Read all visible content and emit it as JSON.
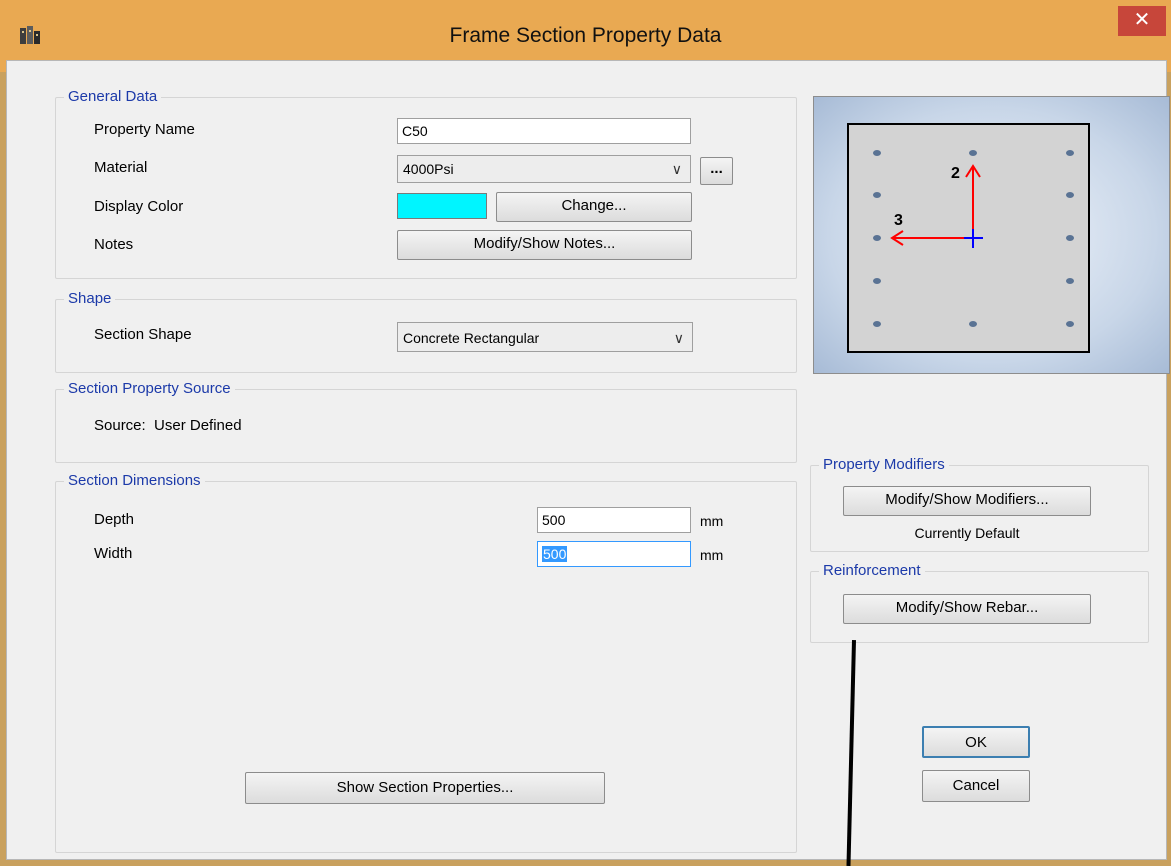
{
  "window": {
    "title": "Frame Section Property Data",
    "close_glyph": "✕"
  },
  "general_data": {
    "group_label": "General Data",
    "property_name_label": "Property Name",
    "property_name_value": "C50",
    "material_label": "Material",
    "material_value": "4000Psi",
    "material_more_label": "...",
    "display_color_label": "Display Color",
    "display_color_hex": "#00f5ff",
    "change_button_label": "Change...",
    "notes_label": "Notes",
    "notes_button_label": "Modify/Show Notes..."
  },
  "shape": {
    "group_label": "Shape",
    "section_shape_label": "Section Shape",
    "section_shape_value": "Concrete Rectangular"
  },
  "source": {
    "group_label": "Section Property Source",
    "source_text": "Source:  User Defined"
  },
  "dimensions": {
    "group_label": "Section Dimensions",
    "depth_label": "Depth",
    "depth_value": "500",
    "depth_unit": "mm",
    "width_label": "Width",
    "width_value": "500",
    "width_unit": "mm"
  },
  "preview": {
    "axis_2_label": "2",
    "axis_3_label": "3"
  },
  "property_modifiers": {
    "group_label": "Property Modifiers",
    "button_label": "Modify/Show Modifiers...",
    "status_text": "Currently Default"
  },
  "reinforcement": {
    "group_label": "Reinforcement",
    "button_label": "Modify/Show Rebar..."
  },
  "footer": {
    "show_props_label": "Show Section Properties...",
    "ok_label": "OK",
    "cancel_label": "Cancel"
  },
  "colors": {
    "titlebar": "#e9a952",
    "close_button": "#c7463a",
    "group_label_text": "#1c3aa9",
    "rebar_dot": "#5a7394",
    "axis_red": "#ff0000",
    "axis_blue": "#0000ff"
  }
}
